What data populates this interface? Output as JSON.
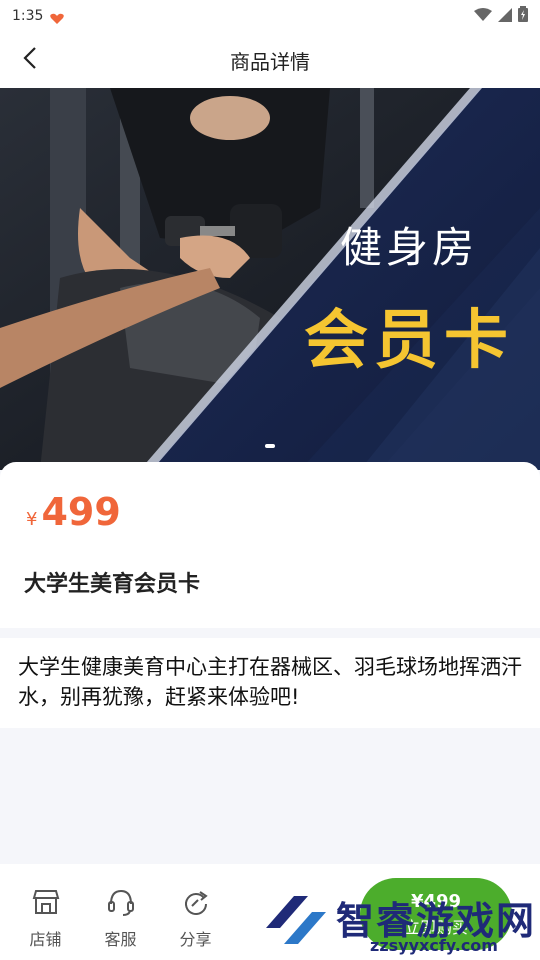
{
  "status_bar": {
    "time": "1:35"
  },
  "nav": {
    "title": "商品详情"
  },
  "banner": {
    "line1": "健身房",
    "line2": "会员卡"
  },
  "product": {
    "currency": "¥",
    "price": "499",
    "name": "大学生美育会员卡",
    "description": "大学生健康美育中心主打在器械区、羽毛球场地挥洒汗水，别再犹豫，赶紧来体验吧!"
  },
  "toolbar": {
    "items": [
      {
        "label": "店铺",
        "icon": "store-icon"
      },
      {
        "label": "客服",
        "icon": "headset-icon"
      },
      {
        "label": "分享",
        "icon": "share-icon"
      }
    ]
  },
  "buy": {
    "price": "¥499",
    "label": "立即购买"
  },
  "watermark": {
    "text": "智睿游戏网",
    "url": "zzsyyxcfy.com"
  }
}
